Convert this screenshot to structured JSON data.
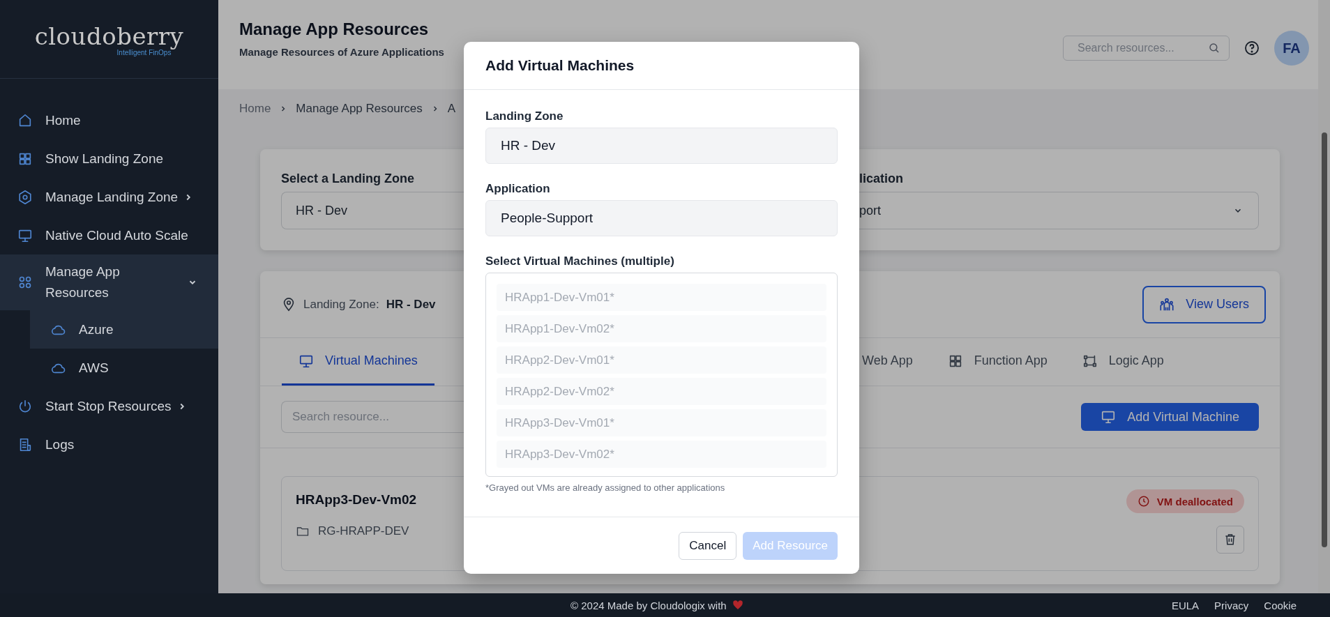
{
  "sidebar": {
    "logo": "cloudoberry",
    "tagline": "Intelligent FinOps",
    "items": [
      {
        "label": "Home",
        "selected": false
      },
      {
        "label": "Show Landing Zone",
        "selected": false
      },
      {
        "label": "Manage Landing Zone",
        "selected": false,
        "expanded": false
      },
      {
        "label": "Native Cloud Auto Scale",
        "selected": false
      },
      {
        "label": "Manage App Resources",
        "selected": false,
        "expanded": true,
        "children": [
          {
            "label": "Azure",
            "selected": true
          },
          {
            "label": "AWS",
            "selected": false
          }
        ]
      },
      {
        "label": "Start Stop Resources",
        "selected": false,
        "expanded": false
      },
      {
        "label": "Logs",
        "selected": false
      }
    ]
  },
  "header": {
    "title": "Manage App Resources",
    "subtitle": "Manage Resources of Azure Applications",
    "search": {
      "placeholder": "Search resources..."
    },
    "avatar": "FA"
  },
  "breadcrumb": [
    "Home",
    "Manage App Resources",
    "A"
  ],
  "selection": {
    "landing_zone": {
      "label": "Select a Landing Zone",
      "value": "HR - Dev"
    },
    "application": {
      "label": "lication",
      "value": "port"
    }
  },
  "resources": {
    "landing_zone_label": "Landing Zone:",
    "landing_zone_value": "HR - Dev",
    "view_users": "View Users",
    "tabs": [
      {
        "label": "Virtual Machines",
        "selected": true
      },
      {
        "label": "Web App",
        "selected": false
      },
      {
        "label": "Function App",
        "selected": false
      },
      {
        "label": "Logic App",
        "selected": false
      }
    ],
    "search": {
      "placeholder": "Search resource..."
    },
    "add_button": "Add Virtual Machine",
    "items": [
      {
        "name": "HRApp3-Dev-Vm02",
        "resource_group": "RG-HRAPP-DEV",
        "status": "VM deallocated"
      }
    ]
  },
  "modal": {
    "title": "Add Virtual Machines",
    "fields": [
      {
        "label": "Landing Zone",
        "value": "HR - Dev"
      },
      {
        "label": "Application",
        "value": "People-Support"
      }
    ],
    "list_label": "Select Virtual Machines (multiple)",
    "vms": [
      {
        "name": "HRApp1-Dev-Vm01*",
        "disabled": true
      },
      {
        "name": "HRApp1-Dev-Vm02*",
        "disabled": true
      },
      {
        "name": "HRApp2-Dev-Vm01*",
        "disabled": true
      },
      {
        "name": "HRApp2-Dev-Vm02*",
        "disabled": true
      },
      {
        "name": "HRApp3-Dev-Vm01*",
        "disabled": true
      },
      {
        "name": "HRApp3-Dev-Vm02*",
        "disabled": true
      }
    ],
    "note": "*Grayed out VMs are already assigned to other applications",
    "buttons": [
      {
        "label": "Cancel",
        "kind": "secondary",
        "disabled": false
      },
      {
        "label": "Add Resource",
        "kind": "primary",
        "disabled": true
      }
    ]
  },
  "footer": {
    "copyright": "© 2024 Made by Cloudologix with",
    "links": [
      "EULA",
      "Privacy",
      "Cookie"
    ]
  }
}
